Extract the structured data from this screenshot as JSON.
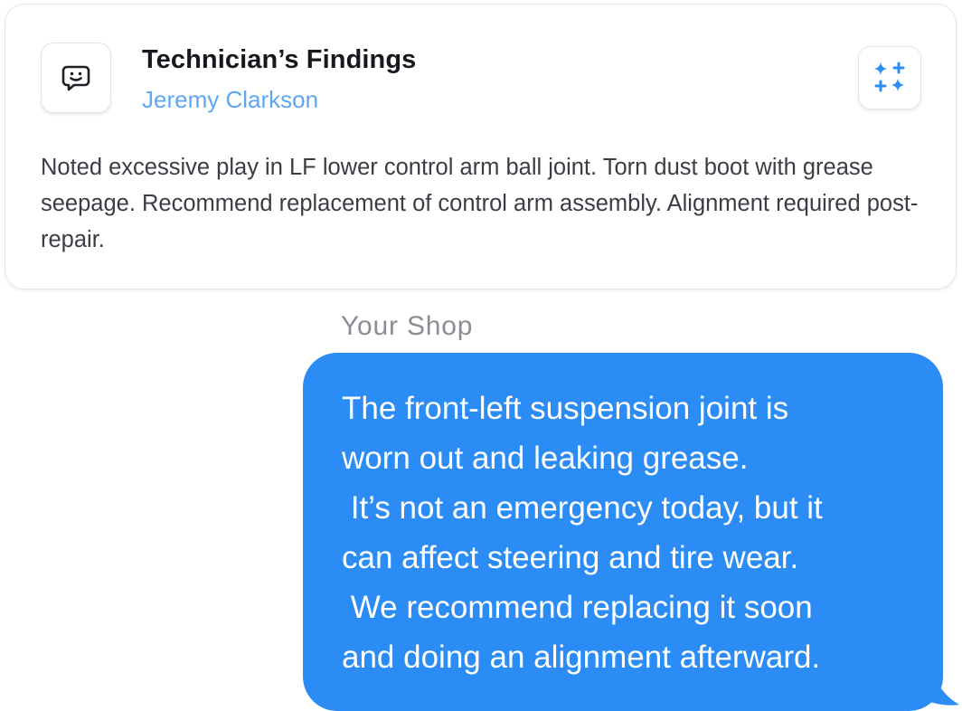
{
  "card": {
    "title": "Technician’s Findings",
    "author": "Jeremy Clarkson",
    "findings": "Noted excessive play in LF lower control arm ball joint. Torn dust boot with grease seepage. Recommend replacement of control arm assembly. Alignment required post-repair.",
    "avatar_icon": "smiley-chat-icon",
    "action_icon": "sparkles-icon"
  },
  "message": {
    "sender": "Your Shop",
    "lines": [
      "The front-left suspension joint is",
      "worn out and leaking grease.",
      " It’s not an emergency today, but it",
      "can affect steering and tire wear.",
      " We recommend replacing it soon",
      "and doing an alignment afterward."
    ]
  },
  "colors": {
    "bubble": "#2b8cf5",
    "author": "#5ea6f3",
    "sparkle": "#2b8cf5"
  }
}
